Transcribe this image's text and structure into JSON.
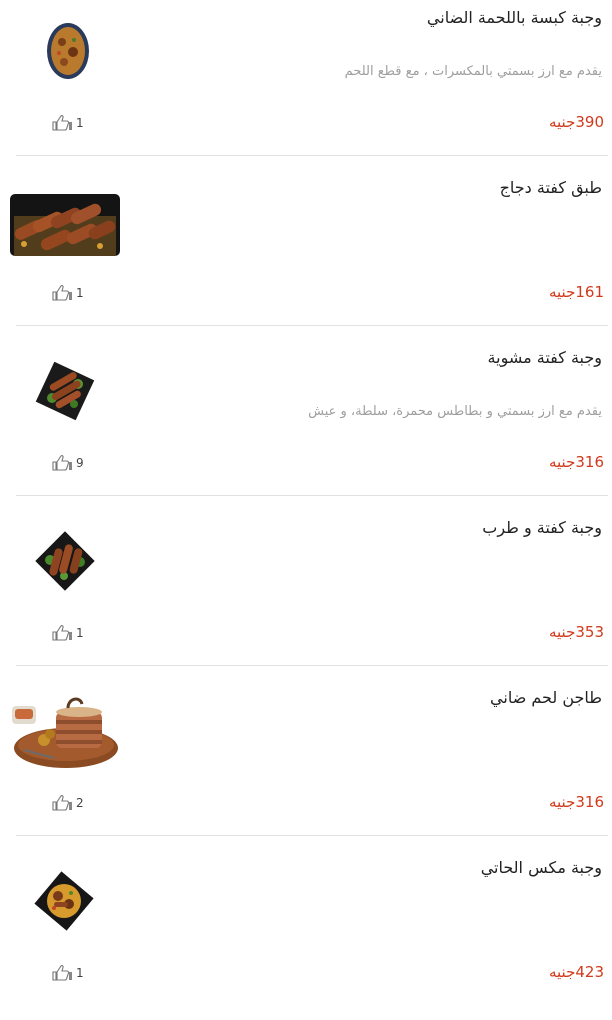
{
  "items": [
    {
      "title": "وجبة كبسة باللحمة الضاني",
      "description": "يقدم مع ارز بسمتي بالمكسرات ، مع قطع اللحم",
      "price": "390جنيه",
      "likes": "1",
      "image_icon": "kabsa-dish-photo"
    },
    {
      "title": "طبق كفتة دجاج",
      "description": "",
      "price": "161جنيه",
      "likes": "1",
      "image_icon": "chicken-kofta-photo"
    },
    {
      "title": "وجبة كفتة مشوية",
      "description": "يقدم مع ارز بسمتي و بطاطس محمرة، سلطة، و عيش",
      "price": "316جنيه",
      "likes": "9",
      "image_icon": "grilled-kofta-photo"
    },
    {
      "title": "وجبة كفتة و طرب",
      "description": "",
      "price": "353جنيه",
      "likes": "1",
      "image_icon": "kofta-tarb-photo"
    },
    {
      "title": "طاجن لحم ضاني",
      "description": "",
      "price": "316جنيه",
      "likes": "2",
      "image_icon": "lamb-tagine-photo"
    },
    {
      "title": "وجبة مكس الحاتي",
      "description": "",
      "price": "423جنيه",
      "likes": "1",
      "image_icon": "mix-hati-photo"
    }
  ],
  "colors": {
    "price": "#d13a1c",
    "title": "#222222",
    "description": "#9e9e9e",
    "separator": "#e1e1e1"
  }
}
